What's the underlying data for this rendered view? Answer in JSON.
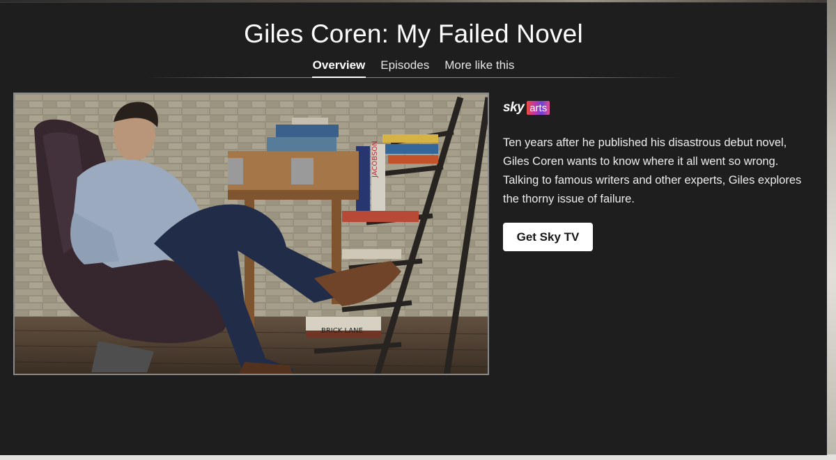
{
  "show": {
    "title": "Giles Coren: My Failed Novel",
    "synopsis": "Ten years after he published his disastrous debut novel, Giles Coren wants to know where it all went so wrong. Talking to famous writers and other experts, Giles explores the thorny issue of failure."
  },
  "tabs": [
    {
      "label": "Overview",
      "active": true
    },
    {
      "label": "Episodes",
      "active": false
    },
    {
      "label": "More like this",
      "active": false
    }
  ],
  "channel": {
    "brand": "sky",
    "name": "arts",
    "icon": "sky-arts-logo"
  },
  "cta": {
    "label": "Get Sky TV"
  },
  "hero_image": {
    "description_icon": "hero-image",
    "book_spine_texts": [
      "JACOBSON",
      "BRICK LANE"
    ]
  },
  "colors": {
    "background": "#1e1e1e",
    "text": "#ffffff",
    "button_bg": "#ffffff",
    "button_text": "#151515"
  }
}
